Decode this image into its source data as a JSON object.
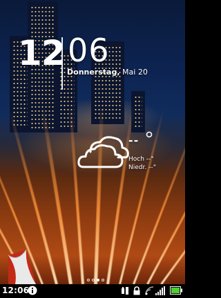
{
  "lockscreen": {
    "hour": "12",
    "minute": "06",
    "weekday": "Donnerstag,",
    "date": "Mai 20"
  },
  "weather": {
    "icon": "cloudy-icon",
    "temperature": "--",
    "high_label": "Hoch --°",
    "low_label": "Niedr. --°"
  },
  "pager": {
    "pages": 4,
    "active_index": 2
  },
  "status_bar": {
    "time": "12:06",
    "icons": [
      "info-icon",
      "usb-debug-icon",
      "lock-icon",
      "wifi-icon",
      "signal-icon",
      "battery-icon"
    ]
  },
  "colors": {
    "accent_green": "#4cd12a",
    "text": "#ffffff"
  }
}
